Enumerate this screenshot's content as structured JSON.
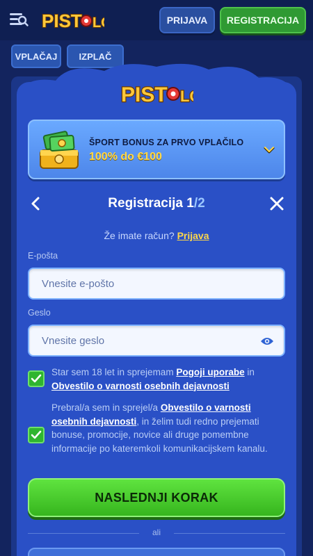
{
  "header": {
    "brand": "PISTOLO",
    "login_label": "PRIJAVA",
    "register_label": "REGISTRACIJA"
  },
  "background_tabs": [
    "VPLAČAJ",
    "IZPLAČ"
  ],
  "modal": {
    "brand": "PISTOLO",
    "bonus": {
      "title": "ŠPORT BONUS ZA PRVO VPLAČILO",
      "amount": "100% do €100"
    },
    "title_prefix": "Registracija 1",
    "title_suffix": "/2",
    "have_account_text": "Že imate račun?",
    "have_account_link": "Prijava",
    "email": {
      "label": "E-pošta",
      "placeholder": "Vnesite e-pošto",
      "value": ""
    },
    "password": {
      "label": "Geslo",
      "placeholder": "Vnesite geslo",
      "value": ""
    },
    "consent_age": {
      "checked": true,
      "text_1": "Star sem 18 let in sprejemam ",
      "link_1": "Pogoji uporabe",
      "text_2": " in ",
      "link_2": "Obvestilo o varnosti osebnih dejavnosti"
    },
    "consent_marketing": {
      "checked": true,
      "text_1": "Prebral/a sem in sprejel/a ",
      "link_1": "Obvestilo o varnosti osebnih dejavnosti",
      "text_2": ", in želim tudi redno prejemati bonuse, promocije, novice ali druge pomembne informacije po kateremkoli komunikacijskem kanalu."
    },
    "next_button": "NASLEDNJI KORAK",
    "divider": "ali"
  },
  "colors": {
    "modal_bg": "#2a50c6",
    "accent_green": "#36b51e",
    "accent_yellow": "#ffd84a"
  },
  "icons": [
    "menu-icon",
    "chevron-down-icon",
    "back-arrow-icon",
    "close-icon",
    "eye-icon",
    "checkmark-icon",
    "money-chest-icon"
  ]
}
